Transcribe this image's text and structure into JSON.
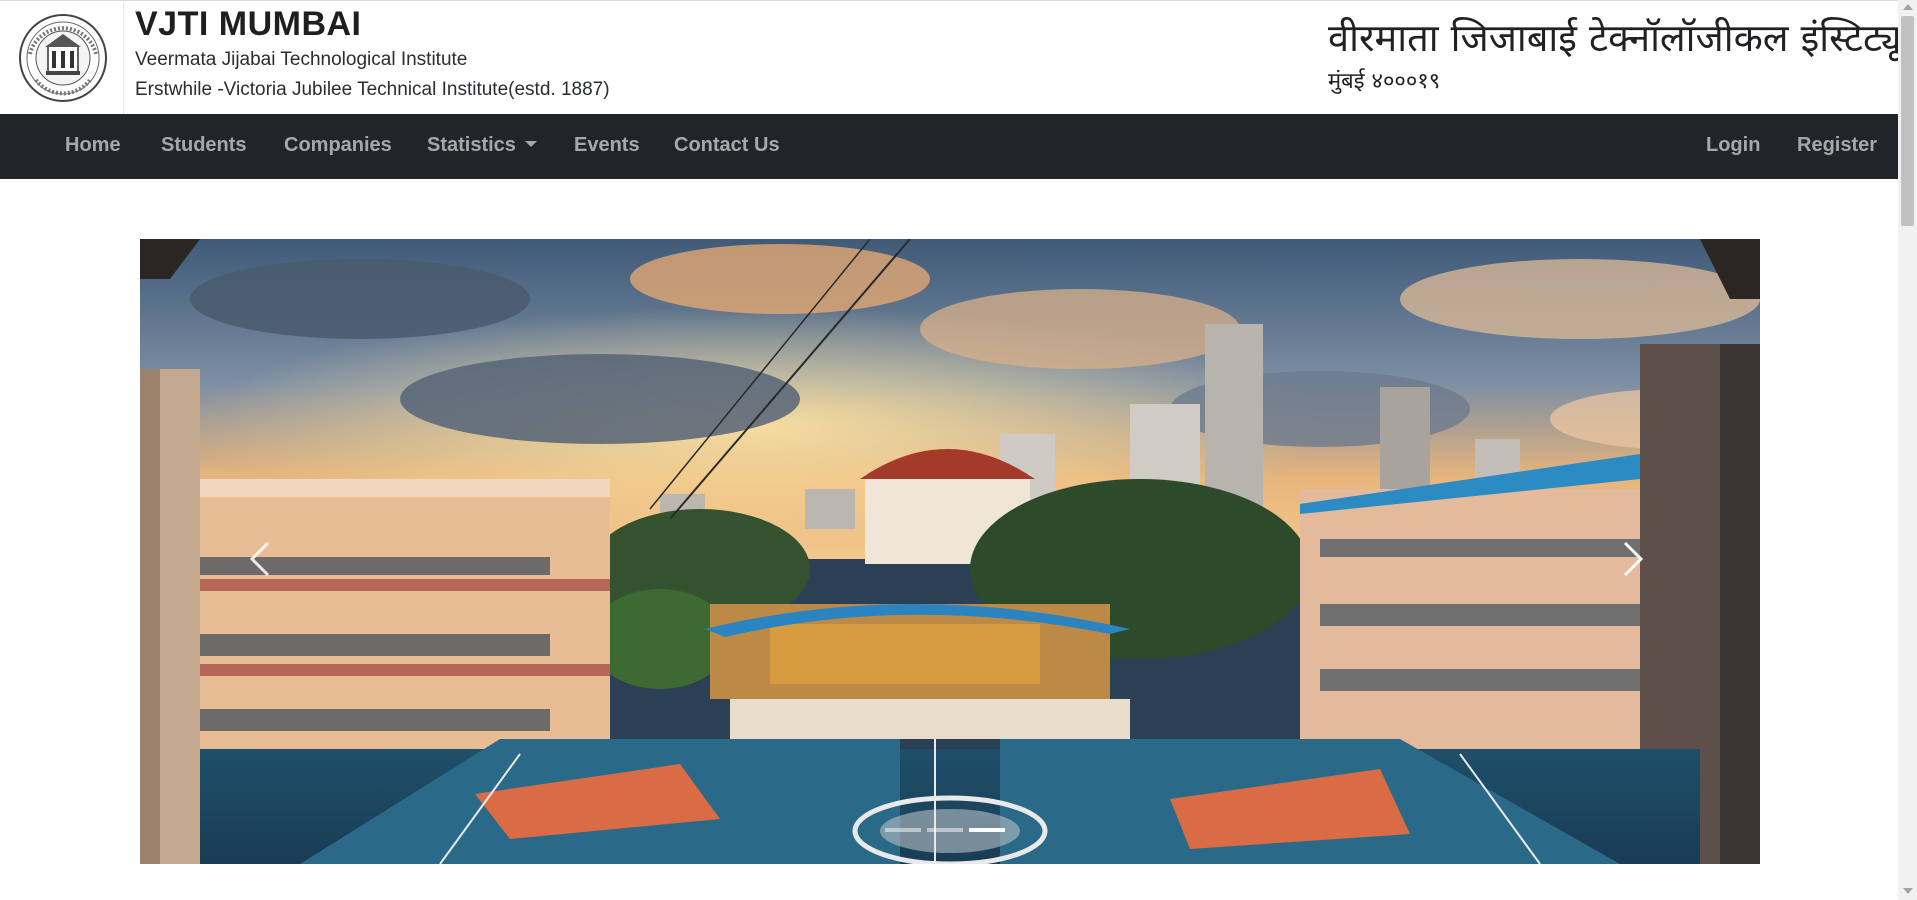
{
  "header": {
    "title": "VJTI MUMBAI",
    "subtitle": "Veermata Jijabai Technological Institute",
    "subtitle2": "Erstwhile -Victoria Jubilee Technical Institute(estd. 1887)",
    "hindi_title": "वीरमाता जिजाबाई टेक्नॉलॉजीकल इंस्टिट्यूट",
    "hindi_address": "मुंबई ४०००१९",
    "logo_icon": "vjti-seal-logo-icon"
  },
  "nav": {
    "left": [
      {
        "label": "Home"
      },
      {
        "label": "Students"
      },
      {
        "label": "Companies"
      },
      {
        "label": "Statistics"
      },
      {
        "label": "Events"
      },
      {
        "label": "Contact Us"
      }
    ],
    "right": [
      {
        "label": "Login"
      },
      {
        "label": "Register"
      }
    ],
    "background": "#212529",
    "link_color": "rgba(255,255,255,0.6)"
  },
  "carousel": {
    "image_icon": "campus-panorama-photo",
    "prev_icon": "chevron-left-icon",
    "next_icon": "chevron-right-icon",
    "slides_count": 3,
    "active_slide": 3
  },
  "colors": {
    "navbar_bg": "#212529",
    "page_bg": "#ffffff",
    "text_dark": "#212529"
  }
}
